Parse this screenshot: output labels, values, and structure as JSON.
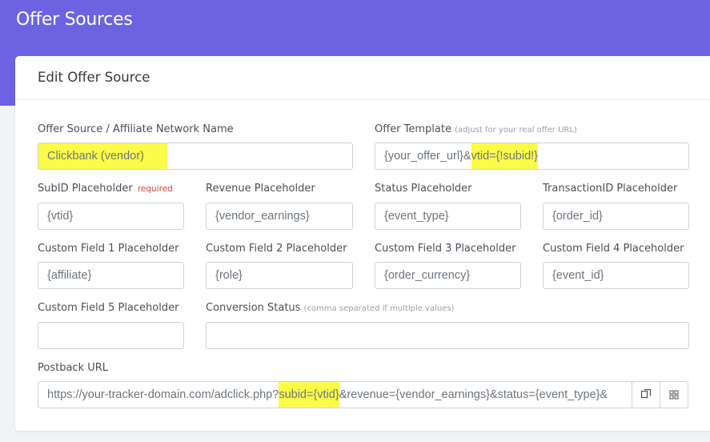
{
  "header": {
    "title": "Offer Sources"
  },
  "card": {
    "title": "Edit Offer Source"
  },
  "form": {
    "name": {
      "label": "Offer Source / Affiliate Network Name",
      "value": "Clickbank (vendor)"
    },
    "template": {
      "label": "Offer Template",
      "hint": "(adjust for your real offer URL)",
      "value_prefix": "{your_offer_url}&",
      "value_highlight": "vtid={!subid!}"
    },
    "subid": {
      "label": "SubID Placeholder",
      "required": "required",
      "value": "{vtid}"
    },
    "revenue": {
      "label": "Revenue Placeholder",
      "value": "{vendor_earnings}"
    },
    "status": {
      "label": "Status Placeholder",
      "value": "{event_type}"
    },
    "transaction": {
      "label": "TransactionID Placeholder",
      "value": "{order_id}"
    },
    "cf1": {
      "label": "Custom Field 1 Placeholder",
      "value": "{affiliate}"
    },
    "cf2": {
      "label": "Custom Field 2 Placeholder",
      "value": "{role}"
    },
    "cf3": {
      "label": "Custom Field 3 Placeholder",
      "value": "{order_currency}"
    },
    "cf4": {
      "label": "Custom Field 4 Placeholder",
      "value": "{event_id}"
    },
    "cf5": {
      "label": "Custom Field 5 Placeholder",
      "value": ""
    },
    "conversion": {
      "label": "Conversion Status",
      "hint": "(comma separated if multiple values)",
      "value": ""
    },
    "postback": {
      "label": "Postback URL",
      "value_prefix": "https://your-tracker-domain.com/adclick.php?",
      "value_highlight": "subid={vtid}",
      "value_suffix": "&revenue={vendor_earnings}&status={event_type}&"
    }
  },
  "icons": {
    "copy": "copy-icon",
    "qr": "qr-code-icon"
  },
  "colors": {
    "accent": "#6c63e3",
    "highlight": "#fbfb49",
    "required": "#e0433a"
  }
}
